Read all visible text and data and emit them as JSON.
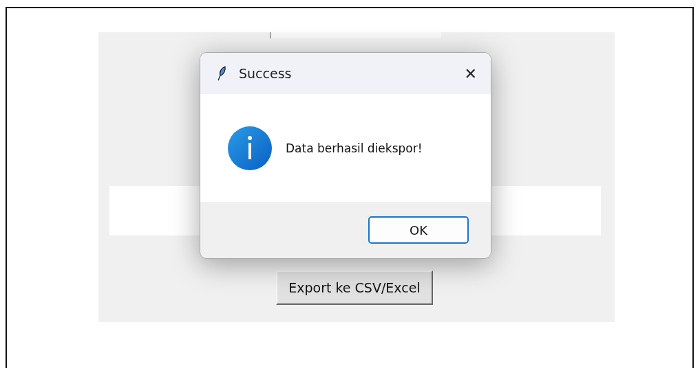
{
  "app": {
    "export_button": "Export ke CSV/Excel"
  },
  "dialog": {
    "title": "Success",
    "close": "✕",
    "message": "Data berhasil diekspor!",
    "buttons": [
      {
        "label": "OK",
        "selected": true
      }
    ]
  }
}
